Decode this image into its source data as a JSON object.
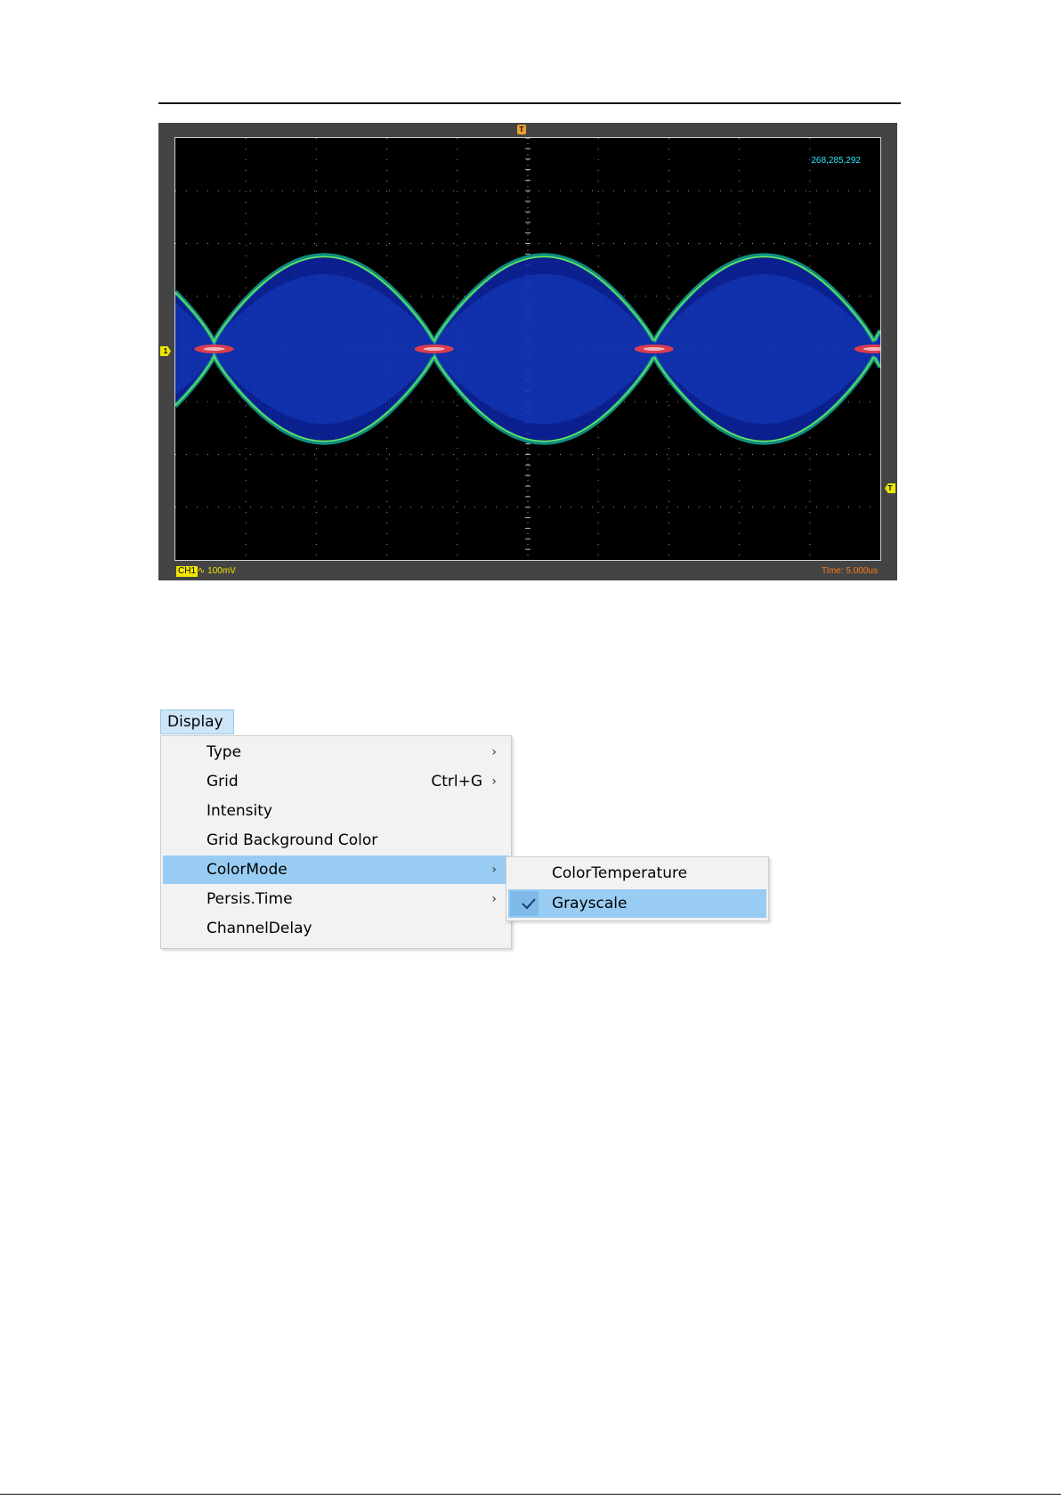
{
  "scope": {
    "sample_counter": "268,285,292",
    "channel_badge": "CH1",
    "channel_scale": "∿ 100mV",
    "time_readout": "Time: 5.000us",
    "trigger_marker": "T",
    "channel_marker": "1",
    "trigger_level_marker": "T",
    "waveform_color_scale": [
      "#0a1f9c",
      "#1e4fe0",
      "#12b0a0",
      "#7df04a",
      "#ff4040"
    ]
  },
  "menu": {
    "title": "Display",
    "items": [
      {
        "label": "Type",
        "shortcut": "",
        "has_submenu": true
      },
      {
        "label": "Grid",
        "shortcut": "Ctrl+G",
        "has_submenu": true
      },
      {
        "label": "Intensity",
        "shortcut": "",
        "has_submenu": false
      },
      {
        "label": "Grid Background Color",
        "shortcut": "",
        "has_submenu": false
      },
      {
        "label": "ColorMode",
        "shortcut": "",
        "has_submenu": true,
        "highlighted": true
      },
      {
        "label": "Persis.Time",
        "shortcut": "",
        "has_submenu": true
      },
      {
        "label": "ChannelDelay",
        "shortcut": "",
        "has_submenu": false
      }
    ],
    "arrow_glyph": "›",
    "highlight_color": "#99ccf3"
  },
  "submenu": {
    "items": [
      {
        "label": "ColorTemperature",
        "checked": false
      },
      {
        "label": "Grayscale",
        "checked": true
      }
    ],
    "check_glyph": "✓"
  }
}
